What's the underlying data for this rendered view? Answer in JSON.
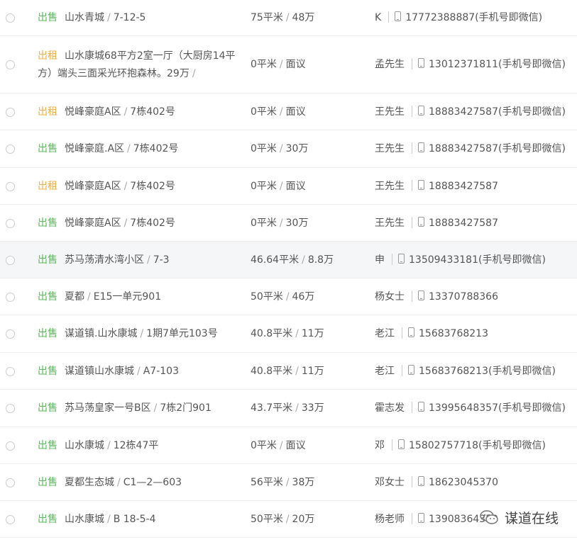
{
  "listings": [
    {
      "type": "出售",
      "kind": "sale",
      "title": "山水青城",
      "unit": "7-12-5",
      "area": "75平米",
      "price": "48万",
      "contact": "K",
      "phone": "17772388887(手机号即微信)"
    },
    {
      "type": "出租",
      "kind": "rent",
      "title": "山水康城68平方2室一厅（大厨房14平方）端头三面采光环抱森林。29万",
      "unit": "",
      "area": "0平米",
      "price": "面议",
      "contact": "孟先生",
      "phone": "13012371811(手机号即微信)"
    },
    {
      "type": "出租",
      "kind": "rent",
      "title": "悦峰豪庭A区",
      "unit": "7栋402号",
      "area": "0平米",
      "price": "面议",
      "contact": "王先生",
      "phone": "18883427587(手机号即微信)"
    },
    {
      "type": "出售",
      "kind": "sale",
      "title": "悦峰豪庭.A区",
      "unit": "7栋402号",
      "area": "0平米",
      "price": "30万",
      "contact": "王先生",
      "phone": "18883427587(手机号即微信)"
    },
    {
      "type": "出租",
      "kind": "rent",
      "title": "悦峰豪庭A区",
      "unit": "7栋402号",
      "area": "0平米",
      "price": "面议",
      "contact": "王先生",
      "phone": "18883427587"
    },
    {
      "type": "出售",
      "kind": "sale",
      "title": "悦峰豪庭A区",
      "unit": "7栋402号",
      "area": "0平米",
      "price": "30万",
      "contact": "王先生",
      "phone": "18883427587"
    },
    {
      "type": "出售",
      "kind": "sale",
      "title": "苏马荡清水湾小区",
      "unit": "7-3",
      "area": "46.64平米",
      "price": "8.8万",
      "contact": "申",
      "phone": "13509433181(手机号即微信)"
    },
    {
      "type": "出售",
      "kind": "sale",
      "title": "夏都",
      "unit": "E15一单元901",
      "area": "50平米",
      "price": "46万",
      "contact": "杨女士",
      "phone": "13370788366"
    },
    {
      "type": "出售",
      "kind": "sale",
      "title": "谋道镇.山水康城",
      "unit": "1期7单元103号",
      "area": "40.8平米",
      "price": "11万",
      "contact": "老江",
      "phone": "15683768213"
    },
    {
      "type": "出售",
      "kind": "sale",
      "title": "谋道镇山水康城",
      "unit": "A7-103",
      "area": "40.8平米",
      "price": "11万",
      "contact": "老江",
      "phone": "15683768213(手机号即微信)"
    },
    {
      "type": "出售",
      "kind": "sale",
      "title": "苏马荡皇家一号B区",
      "unit": "7栋2门901",
      "area": "43.7平米",
      "price": "33万",
      "contact": "霍志发",
      "phone": "13995648357(手机号即微信)"
    },
    {
      "type": "出售",
      "kind": "sale",
      "title": "山水康城",
      "unit": "12栋47平",
      "area": "0平米",
      "price": "面议",
      "contact": "邓",
      "phone": "15802757718(手机号即微信)"
    },
    {
      "type": "出售",
      "kind": "sale",
      "title": "夏都生态城",
      "unit": "C1—2—603",
      "area": "56平米",
      "price": "38万",
      "contact": "邓女士",
      "phone": "18623045370"
    },
    {
      "type": "出售",
      "kind": "sale",
      "title": "山水康城",
      "unit": "B 18-5-4",
      "area": "50平米",
      "price": "20万",
      "contact": "杨老师",
      "phone": "13908364359"
    }
  ],
  "highlighted_index": 6,
  "watermark": {
    "text": "谋道在线",
    "icon": "wechat-icon"
  },
  "colors": {
    "sale": "#5cb85c",
    "rent": "#f0ad4e",
    "highlight": "#f5f6f8",
    "divider": "#eeeeee"
  }
}
